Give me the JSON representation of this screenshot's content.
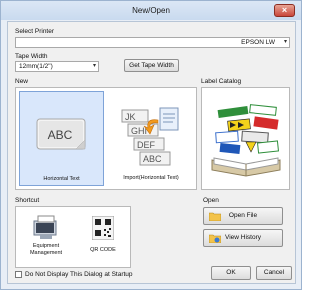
{
  "window": {
    "title": "New/Open",
    "close_glyph": "×"
  },
  "printer": {
    "label": "Select Printer",
    "value": "EPSON LW"
  },
  "tape": {
    "label": "Tape Width",
    "value": "12mm(1/2\")",
    "get_button": "Get Tape Width"
  },
  "new_section": {
    "label": "New",
    "tiles": [
      {
        "caption": "Horizontal Text",
        "icon": "abc-tape-icon",
        "icon_text": "ABC"
      },
      {
        "caption": "Import(Horizontal Text)",
        "icon": "import-text-icon",
        "icon_letters": [
          "JK",
          "GHI",
          "DEF",
          "ABC"
        ]
      }
    ]
  },
  "catalog": {
    "label": "Label Catalog",
    "icon": "label-catalog-book-icon"
  },
  "shortcut": {
    "label": "Shortcut",
    "tiles": [
      {
        "caption_line1": "Equipment",
        "caption_line2": "Management",
        "icon": "equipment-label-icon"
      },
      {
        "caption": "QR CODE",
        "icon": "qr-code-icon"
      }
    ]
  },
  "open_section": {
    "label": "Open",
    "open_file": "Open File",
    "view_history": "View History"
  },
  "footer": {
    "dont_display": "Do Not Display This Dialog at Startup",
    "ok": "OK",
    "cancel": "Cancel"
  },
  "colors": {
    "accent": "#3b7bd4",
    "selected_tile": "#d9e7fb",
    "window_frame": "#9cb3cf"
  }
}
